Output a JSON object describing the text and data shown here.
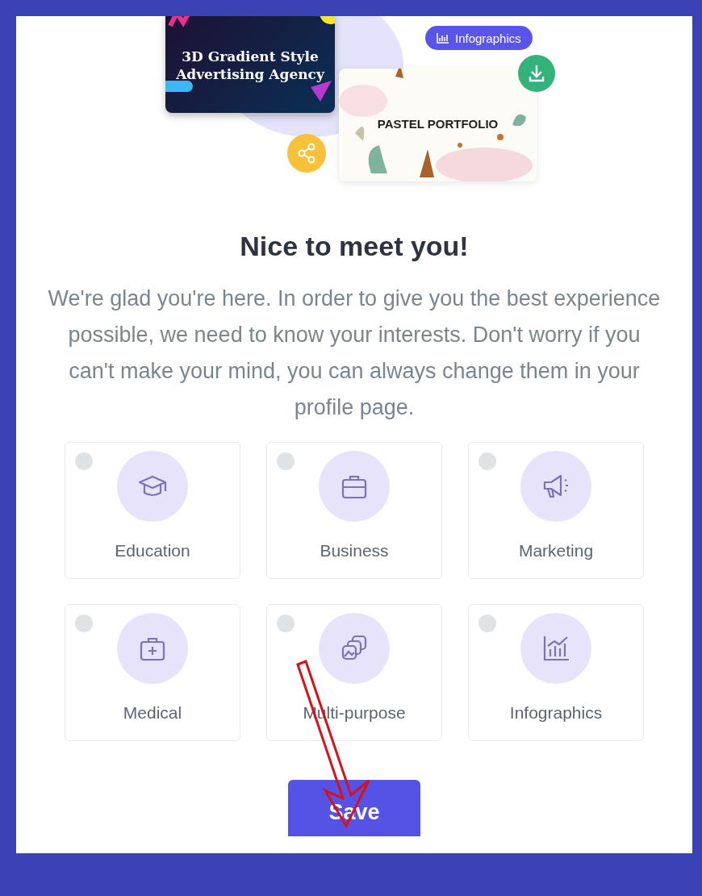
{
  "hero": {
    "dark_template": {
      "title": "3D Gradient Style Advertising Agency"
    },
    "badge": {
      "label": "Infographics"
    },
    "light_template": {
      "title": "PASTEL PORTFOLIO"
    }
  },
  "heading": "Nice to meet you!",
  "intro": "We're glad you're here. In order to give you the best experience possible, we need to know your interests. Don't worry if you can't make your mind, you can always change them in your profile page.",
  "categories": [
    {
      "kind": "education",
      "label": "Education",
      "selected": false
    },
    {
      "kind": "business",
      "label": "Business",
      "selected": false
    },
    {
      "kind": "marketing",
      "label": "Marketing",
      "selected": false
    },
    {
      "kind": "medical",
      "label": "Medical",
      "selected": false
    },
    {
      "kind": "multipurpose",
      "label": "Multi-purpose",
      "selected": false
    },
    {
      "kind": "infographics",
      "label": "Infographics",
      "selected": false
    }
  ],
  "save_button": "Save"
}
